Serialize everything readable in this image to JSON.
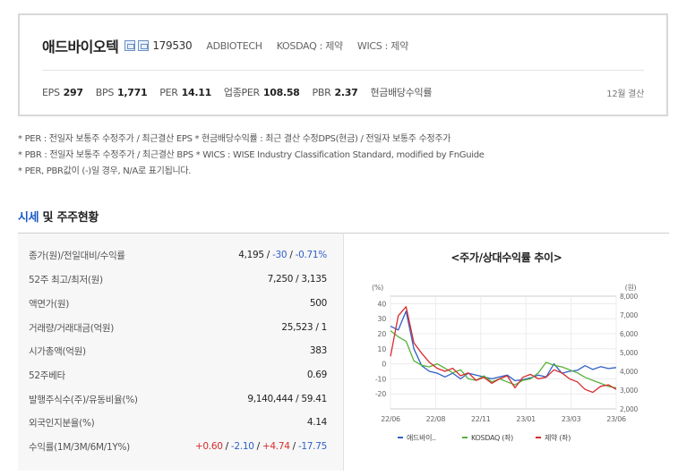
{
  "header": {
    "company_name": "애드바이오텍",
    "code": "179530",
    "english_name": "ADBIOTECH",
    "market": "KOSDAQ : 제약",
    "wics": "WICS : 제약"
  },
  "metrics": {
    "eps_label": "EPS",
    "eps": "297",
    "bps_label": "BPS",
    "bps": "1,771",
    "per_label": "PER",
    "per": "14.11",
    "industry_per_label": "업종PER",
    "industry_per": "108.58",
    "pbr_label": "PBR",
    "pbr": "2.37",
    "dividend_label": "현금배당수익률",
    "dividend": "",
    "settlement": "12월 결산"
  },
  "notes": [
    "* PER : 전일자 보통주 수정주가 / 최근결산 EPS * 현금배당수익률 : 최근 결산 수정DPS(현금) / 전일자 보통주 수정주가",
    "* PBR : 전일자 보통주 수정주가 / 최근결산 BPS * WICS : WISE Industry Classification Standard, modified by FnGuide",
    "* PER, PBR값이 (-)일 경우, N/A로 표기됩니다."
  ],
  "section": {
    "title_accent": "시세",
    "title_rest": " 및 주주현황"
  },
  "table": {
    "rows": [
      {
        "label": "종가(원)/전일대비/수익률",
        "val1": "4,195 / ",
        "val2": "-30",
        "val3": " / ",
        "val4": "-0.71%"
      },
      {
        "label": "52주 최고/최저(원)",
        "value": "7,250 / 3,135"
      },
      {
        "label": "액면가(원)",
        "value": "500"
      },
      {
        "label": "거래량/거래대금(억원)",
        "value": "25,523 / 1"
      },
      {
        "label": "시가총액(억원)",
        "value": "383"
      },
      {
        "label": "52주베타",
        "value": "0.69"
      },
      {
        "label": "발행주식수(주)/유동비율(%)",
        "value": "9,140,444 / 59.41"
      },
      {
        "label": "외국인지분율(%)",
        "value": "4.14"
      },
      {
        "label": "수익률(1M/3M/6M/1Y%)",
        "r1": "+0.60",
        "s1": " / ",
        "r2": "-2.10",
        "s2": " / ",
        "r3": "+4.74",
        "s3": " / ",
        "r4": "-17.75"
      }
    ]
  },
  "chart_data": {
    "type": "line",
    "title": "<주가/상대수익률 추이>",
    "left_axis_unit": "(%)",
    "right_axis_unit": "(원)",
    "left_ylim": [
      -30,
      45
    ],
    "left_ticks": [
      "40",
      "30",
      "20",
      "10",
      "0",
      "-10",
      "-20"
    ],
    "right_ylim": [
      2000,
      8000
    ],
    "right_ticks": [
      "8,000",
      "7,000",
      "6,000",
      "5,000",
      "4,000",
      "3,000",
      "2,000"
    ],
    "x_ticks": [
      "22/06",
      "22/08",
      "22/11",
      "23/01",
      "23/03",
      "23/06"
    ],
    "grid": true,
    "legend_position": "bottom",
    "series": [
      {
        "name": "애드바이..",
        "color": "#2f5fc9",
        "axis": "right",
        "values": [
          6400,
          6200,
          7200,
          5200,
          4300,
          4000,
          3900,
          3700,
          3900,
          3600,
          3900,
          3800,
          3700,
          3600,
          3700,
          3800,
          3500,
          3550,
          3650,
          3800,
          3700,
          4400,
          3900,
          4000,
          4050,
          4300,
          4100,
          4250,
          4150,
          4200
        ]
      },
      {
        "name": "KOSDAQ (좌)",
        "color": "#58b13a",
        "axis": "left",
        "values": [
          22,
          18,
          15,
          2,
          -1,
          -2,
          0,
          -3,
          -6,
          -4,
          -10,
          -11,
          -8,
          -12,
          -10,
          -12,
          -14,
          -11,
          -10,
          -6,
          1,
          -1,
          -2,
          -4,
          -6,
          -9,
          -11,
          -13,
          -15,
          -16
        ]
      },
      {
        "name": "제약 (좌)",
        "color": "#d72c2c",
        "axis": "left",
        "values": [
          5,
          32,
          38,
          14,
          7,
          1,
          -3,
          -5,
          -3,
          -8,
          -6,
          -11,
          -9,
          -13,
          -10,
          -8,
          -16,
          -9,
          -7,
          -10,
          -9,
          -4,
          -6,
          -10,
          -12,
          -17,
          -19,
          -15,
          -14,
          -17
        ]
      }
    ]
  }
}
